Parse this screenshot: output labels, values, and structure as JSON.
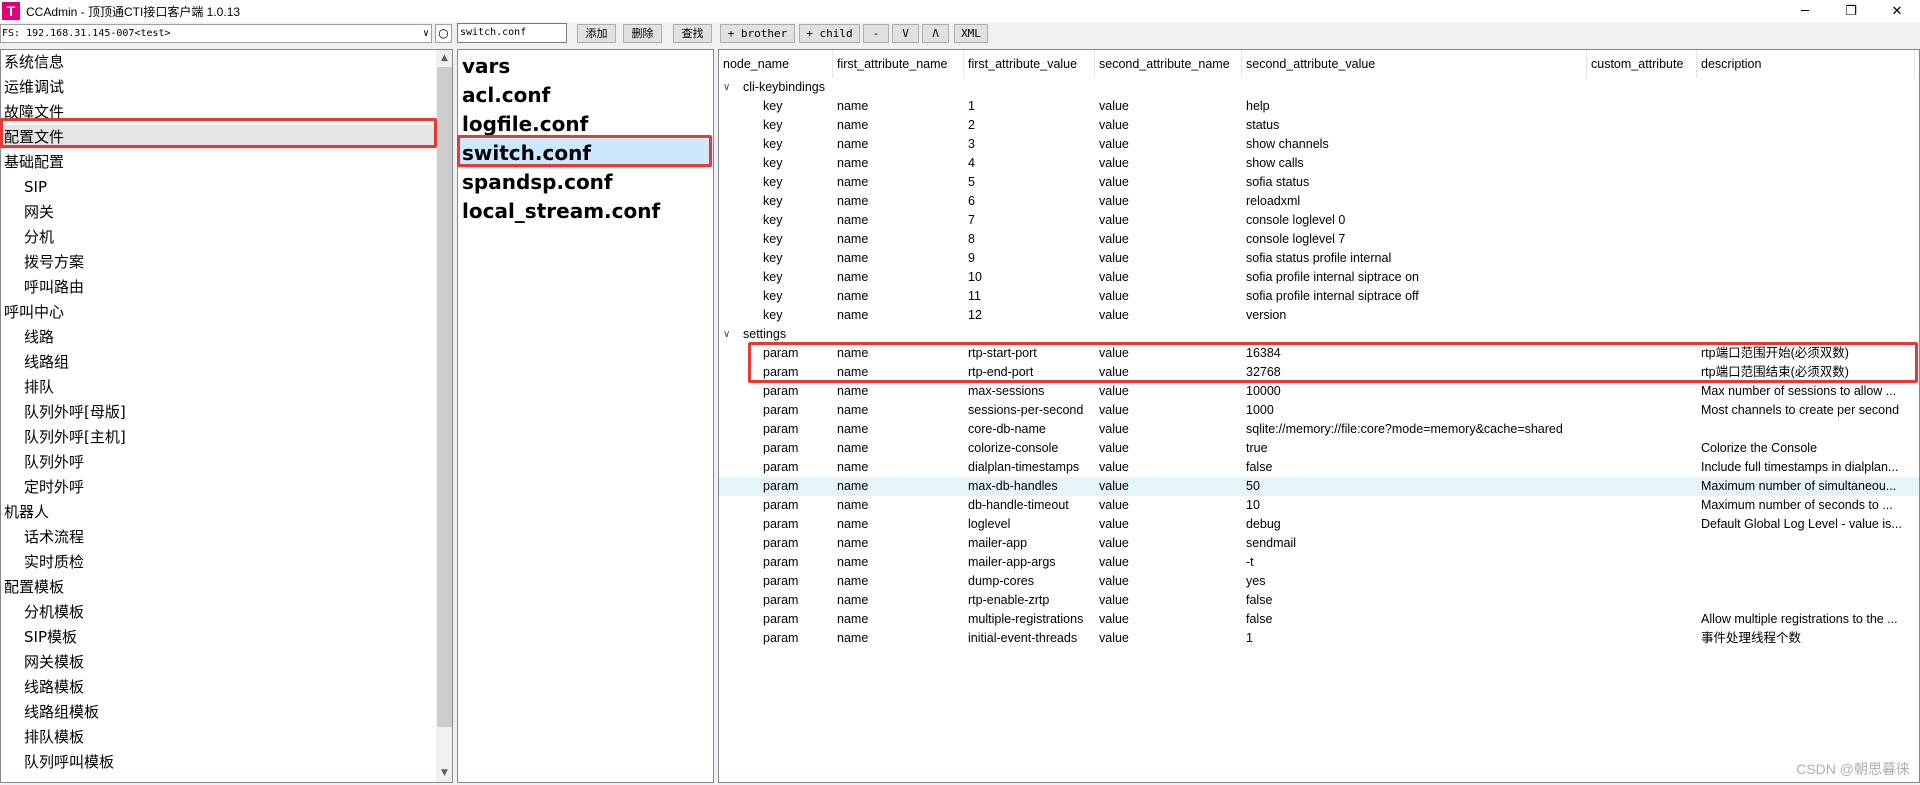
{
  "window": {
    "logo": "T",
    "title": "CCAdmin - 顶顶通CTI接口客户端 1.0.13",
    "controls": [
      "─",
      "❐",
      "✕"
    ]
  },
  "toolbar": {
    "fs_value": "FS: 192.168.31.145-007<test>",
    "refresh": "○",
    "search_value": "switch.conf",
    "add": "添加",
    "delete": "删除",
    "find": "查找",
    "brother": "+ brother",
    "child": "+ child",
    "minus": "-",
    "down": "V",
    "up": "Λ",
    "xml": "XML"
  },
  "nav": [
    {
      "label": "系统信息",
      "level": 0
    },
    {
      "label": "运维调试",
      "level": 0
    },
    {
      "label": "故障文件",
      "level": 0
    },
    {
      "label": "配置文件",
      "level": 0,
      "selected": true
    },
    {
      "label": "基础配置",
      "level": 0
    },
    {
      "label": "SIP",
      "level": 1
    },
    {
      "label": "网关",
      "level": 1
    },
    {
      "label": "分机",
      "level": 1
    },
    {
      "label": "拨号方案",
      "level": 1
    },
    {
      "label": "呼叫路由",
      "level": 1
    },
    {
      "label": "呼叫中心",
      "level": 0
    },
    {
      "label": "线路",
      "level": 1
    },
    {
      "label": "线路组",
      "level": 1
    },
    {
      "label": "排队",
      "level": 1
    },
    {
      "label": "队列外呼[母版]",
      "level": 1
    },
    {
      "label": "队列外呼[主机]",
      "level": 1
    },
    {
      "label": "队列外呼",
      "level": 1
    },
    {
      "label": "定时外呼",
      "level": 1
    },
    {
      "label": "机器人",
      "level": 0
    },
    {
      "label": "话术流程",
      "level": 1
    },
    {
      "label": "实时质检",
      "level": 1
    },
    {
      "label": "配置模板",
      "level": 0
    },
    {
      "label": "分机模板",
      "level": 1
    },
    {
      "label": "SIP模板",
      "level": 1
    },
    {
      "label": "网关模板",
      "level": 1
    },
    {
      "label": "线路模板",
      "level": 1
    },
    {
      "label": "线路组模板",
      "level": 1
    },
    {
      "label": "排队模板",
      "level": 1
    },
    {
      "label": "队列呼叫模板",
      "level": 1
    }
  ],
  "files": [
    {
      "name": "vars"
    },
    {
      "name": "acl.conf"
    },
    {
      "name": "logfile.conf"
    },
    {
      "name": "switch.conf",
      "selected": true
    },
    {
      "name": "spandsp.conf"
    },
    {
      "name": "local_stream.conf"
    }
  ],
  "columns": [
    "node_name",
    "first_attribute_name",
    "first_attribute_value",
    "second_attribute_name",
    "second_attribute_value",
    "custom_attribute",
    "description"
  ],
  "groups": [
    {
      "name": "cli-keybindings",
      "rows": [
        [
          "key",
          "name",
          "1",
          "value",
          "help",
          "",
          ""
        ],
        [
          "key",
          "name",
          "2",
          "value",
          "status",
          "",
          ""
        ],
        [
          "key",
          "name",
          "3",
          "value",
          "show channels",
          "",
          ""
        ],
        [
          "key",
          "name",
          "4",
          "value",
          "show calls",
          "",
          ""
        ],
        [
          "key",
          "name",
          "5",
          "value",
          "sofia status",
          "",
          ""
        ],
        [
          "key",
          "name",
          "6",
          "value",
          "reloadxml",
          "",
          ""
        ],
        [
          "key",
          "name",
          "7",
          "value",
          "console loglevel 0",
          "",
          ""
        ],
        [
          "key",
          "name",
          "8",
          "value",
          "console loglevel 7",
          "",
          ""
        ],
        [
          "key",
          "name",
          "9",
          "value",
          "sofia status profile internal",
          "",
          ""
        ],
        [
          "key",
          "name",
          "10",
          "value",
          "sofia profile internal siptrace on",
          "",
          ""
        ],
        [
          "key",
          "name",
          "11",
          "value",
          "sofia profile internal siptrace off",
          "",
          ""
        ],
        [
          "key",
          "name",
          "12",
          "value",
          "version",
          "",
          ""
        ]
      ]
    },
    {
      "name": "settings",
      "rows": [
        [
          "param",
          "name",
          "rtp-start-port",
          "value",
          "16384",
          "",
          "rtp端口范围开始(必须双数)"
        ],
        [
          "param",
          "name",
          "rtp-end-port",
          "value",
          "32768",
          "",
          "rtp端口范围结束(必须双数)"
        ],
        [
          "param",
          "name",
          "max-sessions",
          "value",
          "10000",
          "",
          "Max number of sessions to allow ..."
        ],
        [
          "param",
          "name",
          "sessions-per-second",
          "value",
          "1000",
          "",
          "Most channels to create per second"
        ],
        [
          "param",
          "name",
          "core-db-name",
          "value",
          "sqlite://memory://file:core?mode=memory&cache=shared",
          "",
          ""
        ],
        [
          "param",
          "name",
          "colorize-console",
          "value",
          "true",
          "",
          "Colorize the Console"
        ],
        [
          "param",
          "name",
          "dialplan-timestamps",
          "value",
          "false",
          "",
          "Include full timestamps in dialplan..."
        ],
        [
          "param",
          "name",
          "max-db-handles",
          "value",
          "50",
          "",
          "Maximum number of simultaneou..."
        ],
        [
          "param",
          "name",
          "db-handle-timeout",
          "value",
          "10",
          "",
          "Maximum number of seconds to ..."
        ],
        [
          "param",
          "name",
          "loglevel",
          "value",
          "debug",
          "",
          "Default Global Log Level - value is..."
        ],
        [
          "param",
          "name",
          "mailer-app",
          "value",
          "sendmail",
          "",
          ""
        ],
        [
          "param",
          "name",
          "mailer-app-args",
          "value",
          "-t",
          "",
          ""
        ],
        [
          "param",
          "name",
          "dump-cores",
          "value",
          "yes",
          "",
          ""
        ],
        [
          "param",
          "name",
          "rtp-enable-zrtp",
          "value",
          "false",
          "",
          ""
        ],
        [
          "param",
          "name",
          "multiple-registrations",
          "value",
          "false",
          "",
          "Allow multiple registrations to the ..."
        ],
        [
          "param",
          "name",
          "initial-event-threads",
          "value",
          "1",
          "",
          "事件处理线程个数"
        ]
      ]
    }
  ],
  "highlighted_row": "max-db-handles",
  "watermark": "CSDN @朝思暮徕",
  "colors": {
    "annotation": "#e53935",
    "selected_file": "#cce8ff",
    "row_highlight": "#e5f3fb"
  }
}
